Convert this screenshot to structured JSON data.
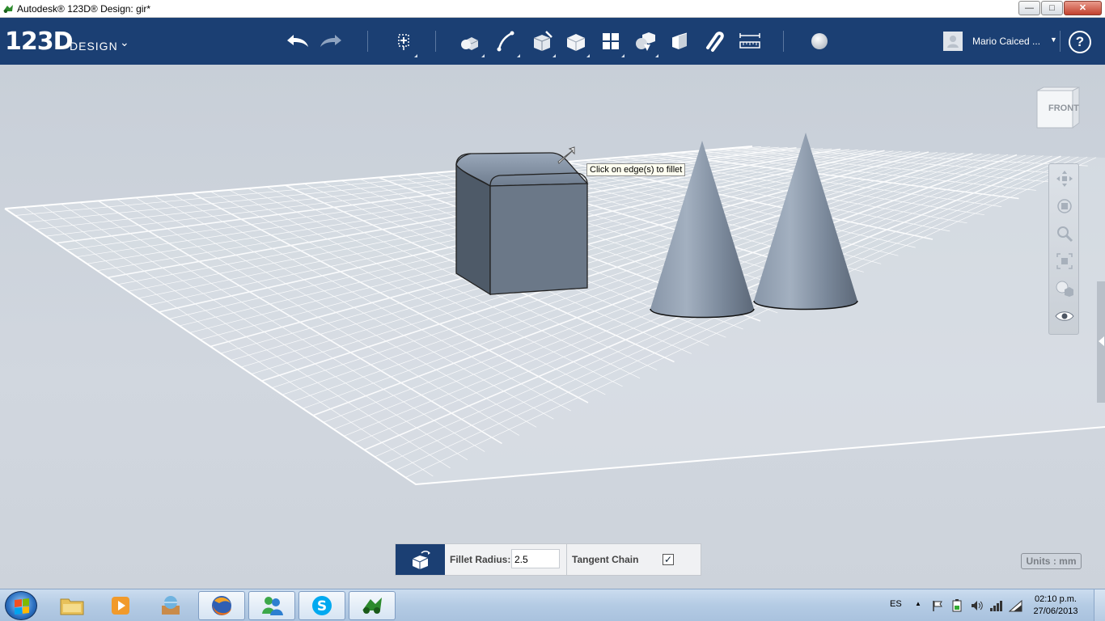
{
  "window": {
    "title": "Autodesk® 123D® Design: gir*",
    "buttons": [
      "—",
      "□",
      "✕"
    ]
  },
  "toolbar": {
    "logo_num": "123D",
    "logo_word": "DESIGN",
    "logo_caret": "⌄",
    "tools": [
      "undo-icon",
      "redo-icon",
      "transform-icon",
      "primitives-icon",
      "sketch-icon",
      "construct-icon",
      "modify-icon",
      "pattern-icon",
      "grouping-icon",
      "combine-icon",
      "snap-icon",
      "measure-icon",
      "material-icon"
    ],
    "user_name": "Mario Caiced ...",
    "user_caret": "▼",
    "help_label": "?"
  },
  "viewport": {
    "tooltip": "Click on edge(s) to fillet",
    "viewcube_label": "FRONT",
    "nav_tools": [
      "pan-icon",
      "orbit-icon",
      "zoom-icon",
      "fit-icon",
      "view-mode-icon",
      "visibility-icon"
    ]
  },
  "fillet_panel": {
    "radius_label": "Fillet Radius:",
    "radius_value": "2.5",
    "tangent_label": "Tangent Chain",
    "tangent_checked": true,
    "check_glyph": "✓"
  },
  "units_label": "Units : mm",
  "taskbar": {
    "apps": [
      "explorer-icon",
      "media-player-icon",
      "game-icon",
      "firefox-icon",
      "messenger-icon",
      "skype-icon",
      "123d-design-icon"
    ],
    "language": "ES",
    "tray_up": "▲",
    "time": "02:10 p.m.",
    "date": "27/06/2013"
  },
  "colors": {
    "toolbar_bg": "#1b3f73",
    "viewport_bg": "#c9d0d9",
    "object_fill": "#6b7888"
  }
}
